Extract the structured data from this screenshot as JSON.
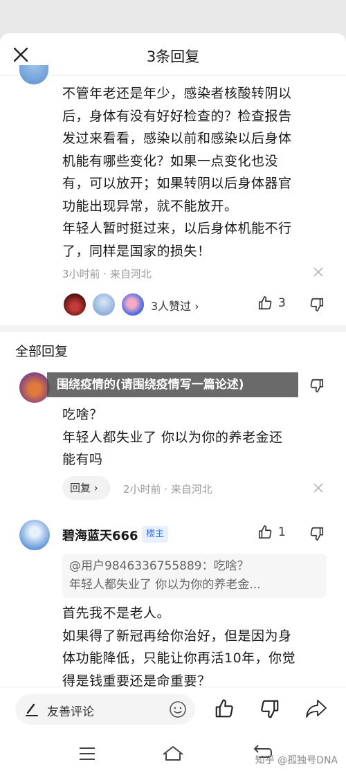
{
  "header": {
    "title": "3条回复"
  },
  "main_comment": {
    "lines": [
      "不管年老还是年少，感染者核酸转阴以",
      "后，身体有没有好好检查的？检查报告",
      "发过来看看，感染以前和感染以后身体",
      "机能有哪些变化？如果一点变化也没",
      "有，可以放开；如果转阴以后身体器官",
      "功能出现异常，就不能放开。",
      "年轻人暂时挺过来，以后身体机能不行",
      "了，同样是国家的损失！"
    ],
    "meta": "3小时前 · 来自河北",
    "likes_text": "3人赞过 ›",
    "like_count": "3"
  },
  "section": {
    "title": "全部回复"
  },
  "banner": {
    "text": "围绕疫情的(请围绕疫情写一篇论述)"
  },
  "reply1": {
    "lines": [
      "吃啥？",
      "年轻人都失业了 你以为你的养老金还",
      "能有吗"
    ],
    "reply_button": "回复 ›",
    "meta": "2小时前 · 来自河北"
  },
  "reply2": {
    "username": "碧海蓝天666",
    "badge": "楼主",
    "like_count": "1",
    "quote_lines": [
      "@用户9846336755889：吃啥？",
      "年轻人都失业了 你以为你的养老金..."
    ],
    "lines": [
      "首先我不是老人。",
      "如果得了新冠再给你治好，但是因为身",
      "体功能降低，只能让你再活10年，你觉",
      "得是钱重要还是命重要？"
    ]
  },
  "bottom": {
    "comment_placeholder": "友善评论"
  },
  "watermark": "知乎 @孤独号DNA",
  "colors": {
    "badge_blue": "#3478f6",
    "badge_bg": "#e8f0fd",
    "meta_gray": "#999999"
  }
}
